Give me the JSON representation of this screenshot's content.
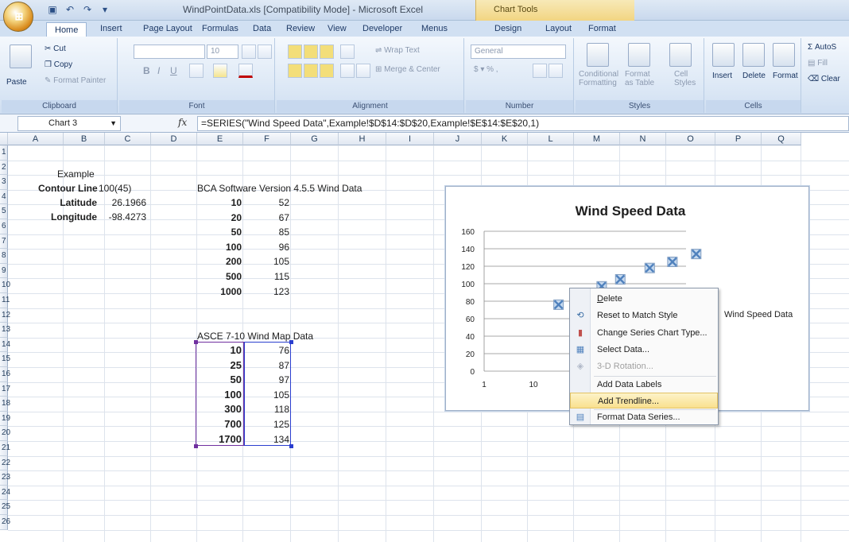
{
  "window": {
    "title": "WindPointData.xls  [Compatibility Mode] - Microsoft Excel",
    "context_tab": "Chart Tools"
  },
  "ribbon_tabs": [
    "Home",
    "Insert",
    "Page Layout",
    "Formulas",
    "Data",
    "Review",
    "View",
    "Developer",
    "Menus",
    "Design",
    "Layout",
    "Format"
  ],
  "ribbon": {
    "clipboard": {
      "paste": "Paste",
      "cut": "Cut",
      "copy": "Copy",
      "format_painter": "Format Painter",
      "label": "Clipboard"
    },
    "font": {
      "size": "10",
      "label": "Font"
    },
    "alignment": {
      "wrap": "Wrap Text",
      "merge": "Merge & Center",
      "label": "Alignment"
    },
    "number": {
      "format": "General",
      "label": "Number"
    },
    "styles": {
      "conditional": "Conditional",
      "conditional2": "Formatting",
      "format_table": "Format",
      "format_table2": "as Table",
      "cell_styles": "Cell",
      "cell_styles2": "Styles",
      "label": "Styles"
    },
    "cells": {
      "insert": "Insert",
      "delete": "Delete",
      "format": "Format",
      "label": "Cells"
    },
    "editing": {
      "autosum": "AutoS",
      "fill": "Fill",
      "clear": "Clear"
    }
  },
  "formula_bar": {
    "name_box": "Chart 3",
    "fx": "fx",
    "formula": "=SERIES(\"Wind Speed Data\",Example!$D$14:$D$20,Example!$E$14:$E$20,1)"
  },
  "columns": [
    "A",
    "B",
    "C",
    "D",
    "E",
    "F",
    "G",
    "H",
    "I",
    "J",
    "K",
    "L",
    "M",
    "N",
    "O",
    "P",
    "Q"
  ],
  "rows": [
    "1",
    "2",
    "3",
    "4",
    "5",
    "6",
    "7",
    "8",
    "9",
    "10",
    "11",
    "12",
    "13",
    "14",
    "15",
    "16",
    "17",
    "18",
    "19",
    "20",
    "21",
    "22",
    "23",
    "24",
    "25",
    "26"
  ],
  "sheet": {
    "example": "Example",
    "contour_label": "Contour Line",
    "contour_value": "100(45)",
    "latitude_label": "Latitude",
    "latitude_value": "26.1966",
    "longitude_label": "Longitude",
    "longitude_value": "-98.4273",
    "bca_title": "BCA Software Version 4.5.5 Wind Data",
    "bca_rows": [
      [
        "10",
        "52"
      ],
      [
        "20",
        "67"
      ],
      [
        "50",
        "85"
      ],
      [
        "100",
        "96"
      ],
      [
        "200",
        "105"
      ],
      [
        "500",
        "115"
      ],
      [
        "1000",
        "123"
      ]
    ],
    "asce_title": "ASCE 7-10 Wind Map Data",
    "asce_rows": [
      [
        "10",
        "76"
      ],
      [
        "25",
        "87"
      ],
      [
        "50",
        "97"
      ],
      [
        "100",
        "105"
      ],
      [
        "300",
        "118"
      ],
      [
        "700",
        "125"
      ],
      [
        "1700",
        "134"
      ]
    ]
  },
  "chart_data": {
    "type": "scatter",
    "title": "Wind Speed Data",
    "series": [
      {
        "name": "Wind Speed Data",
        "x": [
          10,
          25,
          50,
          100,
          300,
          700,
          1700
        ],
        "y": [
          76,
          87,
          97,
          105,
          118,
          125,
          134
        ]
      }
    ],
    "xlabel": "",
    "ylabel": "",
    "x_scale": "log",
    "x_ticks": [
      "1",
      "10"
    ],
    "y_ticks": [
      "0",
      "20",
      "40",
      "60",
      "80",
      "100",
      "120",
      "140",
      "160"
    ],
    "ylim": [
      0,
      160
    ],
    "grid": "horizontal",
    "legend": "right",
    "marker_color": "#4f81bd"
  },
  "context_menu": {
    "items": [
      {
        "label": "Delete",
        "icon": ""
      },
      {
        "label": "Reset to Match Style",
        "icon": "reset-icon"
      },
      {
        "label": "Change Series Chart Type...",
        "icon": "chart-type-icon"
      },
      {
        "label": "Select Data...",
        "icon": "select-data-icon"
      },
      {
        "label": "3-D Rotation...",
        "icon": "rotation-icon"
      },
      {
        "label": "Add Data Labels",
        "icon": ""
      },
      {
        "label": "Add Trendline...",
        "icon": ""
      },
      {
        "label": "Format Data Series...",
        "icon": "format-series-icon"
      }
    ]
  }
}
